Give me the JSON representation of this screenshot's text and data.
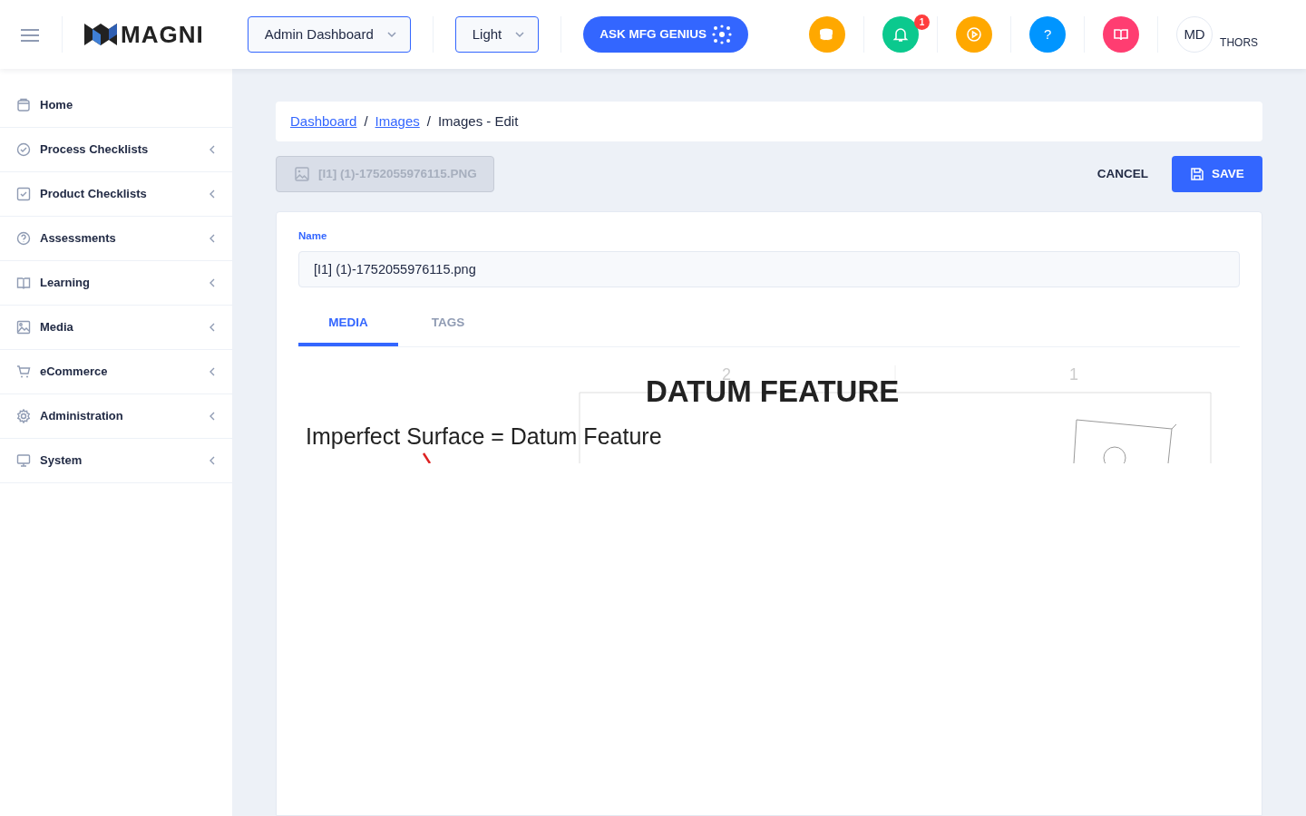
{
  "header": {
    "brand": "MAGNI",
    "dashboard_select": "Admin Dashboard",
    "theme_select": "Light",
    "genius_button": "ASK MFG GENIUS",
    "icon_buttons": [
      {
        "color": "#ffa800"
      },
      {
        "color": "#0bc98e",
        "badge": "1"
      },
      {
        "color": "#ffa800"
      },
      {
        "color": "#0095ff",
        "glyph": "?"
      },
      {
        "color": "#ff3d71"
      }
    ],
    "user": {
      "initials": "MD",
      "org": "THORS"
    }
  },
  "sidebar": {
    "items": [
      {
        "label": "Home",
        "expandable": false
      },
      {
        "label": "Process Checklists",
        "expandable": true
      },
      {
        "label": "Product Checklists",
        "expandable": true
      },
      {
        "label": "Assessments",
        "expandable": true
      },
      {
        "label": "Learning",
        "expandable": true
      },
      {
        "label": "Media",
        "expandable": true
      },
      {
        "label": "eCommerce",
        "expandable": true
      },
      {
        "label": "Administration",
        "expandable": true
      },
      {
        "label": "System",
        "expandable": true
      }
    ]
  },
  "breadcrumb_separators": [
    "/",
    "/"
  ],
  "breadcrumb": [
    {
      "label": "Dashboard",
      "link": true
    },
    {
      "label": "Images",
      "link": true
    },
    {
      "label": "Images - Edit",
      "link": false
    }
  ],
  "file_chip": "[I1] (1)-1752055976115.PNG",
  "actions": {
    "cancel": "CANCEL",
    "save": "SAVE"
  },
  "form": {
    "name_label": "Name",
    "name_value": "[I1] (1)-1752055976115.png"
  },
  "tabs": [
    {
      "label": "MEDIA",
      "selected": true
    },
    {
      "label": "TAGS",
      "selected": false
    }
  ],
  "image": {
    "title": "DATUM FEATURE",
    "caption": "Imperfect Surface = Datum Feature",
    "marks": [
      "2",
      "1"
    ]
  }
}
